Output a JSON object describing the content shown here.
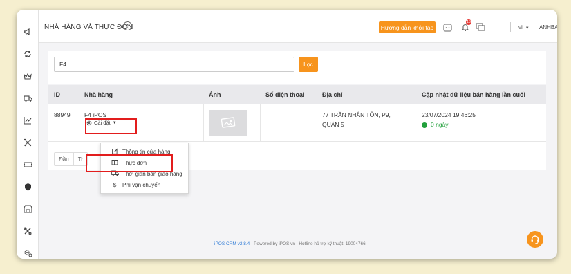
{
  "header": {
    "title": "NHÀ HÀNG VÀ THỰC ĐƠN",
    "guide_button": "Hướng dẫn khởi tạo",
    "notification_count": "13",
    "language": "vi",
    "username": "ANHBA"
  },
  "sidebar": {
    "icons": [
      "megaphone-icon",
      "sync-icon",
      "crown-icon",
      "delivery-truck-icon",
      "line-chart-icon",
      "network-icon",
      "ticket-icon",
      "shield-icon",
      "store-icon",
      "tools-icon",
      "settings-gears-icon"
    ]
  },
  "filter": {
    "search_value": "F4",
    "filter_button": "Lọc"
  },
  "table": {
    "columns": [
      "ID",
      "Nhà hàng",
      "Ảnh",
      "Số điện thoại",
      "Địa chỉ",
      "Cập nhật dữ liệu bán hàng lần cuối"
    ],
    "rows": [
      {
        "id": "88949",
        "name": "F4 iPOS",
        "settings": "Cài đặt",
        "phone": "",
        "address_line1": "77 TRẦN NHÂN TÔN, P9,",
        "address_line2": "QUẬN 5",
        "last_update": "23/07/2024 19:46:25",
        "sync_status": "0 ngày"
      }
    ]
  },
  "pagination": {
    "first": "Đầu",
    "prev_partial": "Tr"
  },
  "settings_menu": {
    "items": [
      "Thông tin cửa hàng",
      "Thực đơn",
      "Thời gian bán giao hàng",
      "Phí vận chuyển"
    ]
  },
  "footer": {
    "version": "iPOS CRM v2.8.4",
    "text": " - Powered by iPOS.vn | Hotline hỗ trợ kỹ thuật: 19004766"
  },
  "colors": {
    "accent": "#f7941d",
    "highlight": "#e21d1d",
    "success": "#22a03c",
    "link": "#2f7bd6"
  }
}
